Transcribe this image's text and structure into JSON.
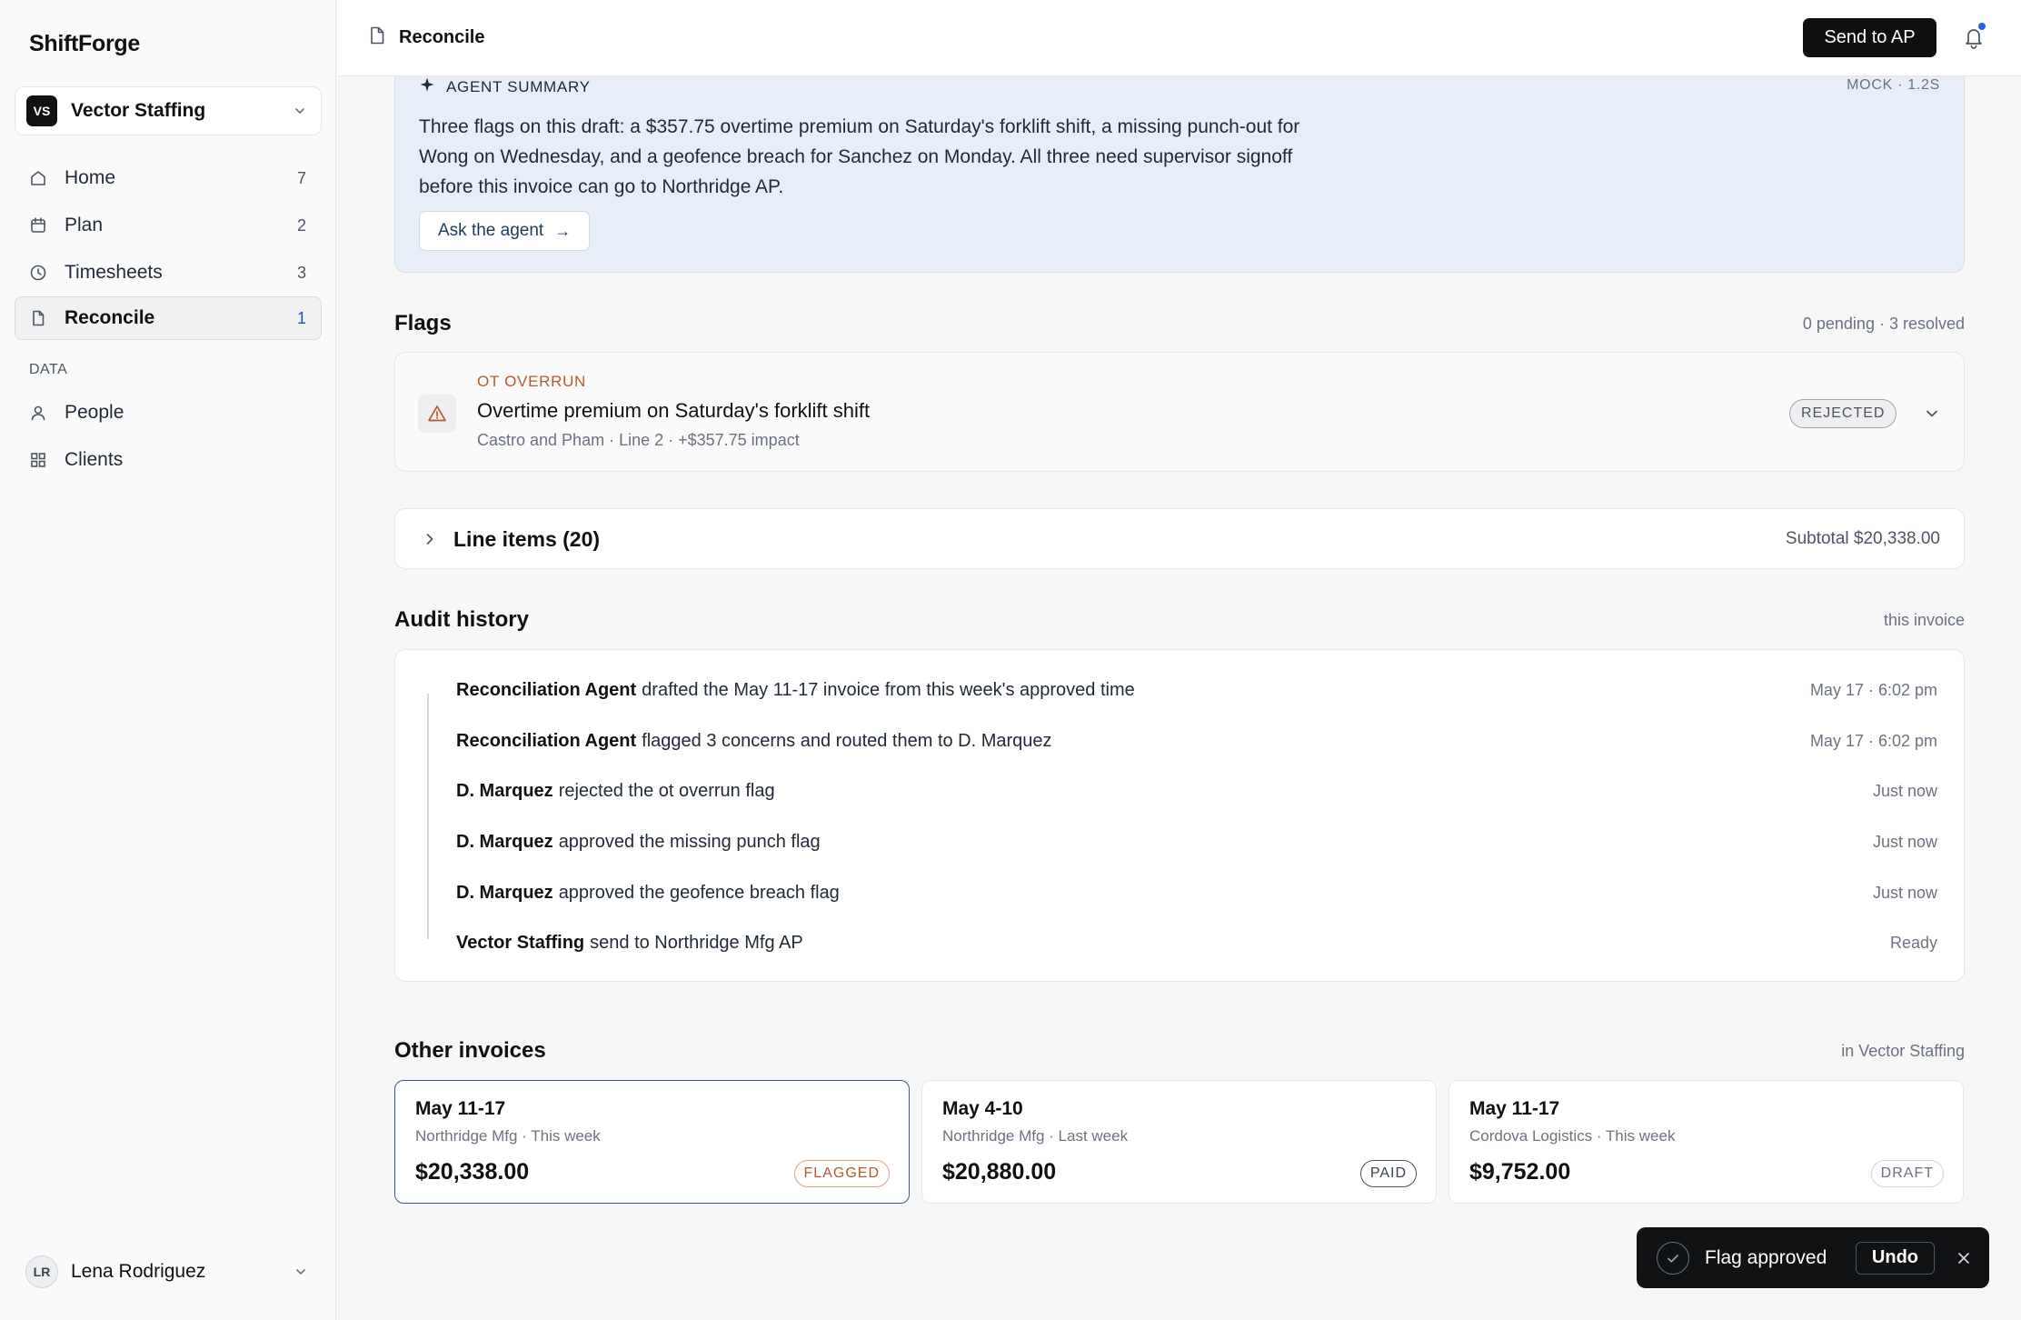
{
  "app": {
    "brand": "ShiftForge"
  },
  "workspace": {
    "initials": "VS",
    "name": "Vector Staffing"
  },
  "nav": [
    {
      "label": "Home",
      "count": "7",
      "icon": "home-icon"
    },
    {
      "label": "Plan",
      "count": "2",
      "icon": "calendar-icon"
    },
    {
      "label": "Timesheets",
      "count": "3",
      "icon": "clock-icon"
    },
    {
      "label": "Reconcile",
      "count": "1",
      "icon": "document-icon",
      "active": true
    }
  ],
  "data_section": {
    "label": "DATA",
    "items": [
      {
        "label": "People",
        "icon": "person-icon"
      },
      {
        "label": "Clients",
        "icon": "grid-icon"
      }
    ]
  },
  "user": {
    "initials": "LR",
    "name": "Lena Rodriguez"
  },
  "topbar": {
    "crumb": "Reconcile",
    "send_label": "Send to AP"
  },
  "agent": {
    "title": "AGENT SUMMARY",
    "meta": "MOCK · 1.2S",
    "text": "Three flags on this draft: a $357.75 overtime premium on Saturday's forklift shift, a missing punch-out for Wong on Wednesday, and a geofence breach for Sanchez on Monday. All three need supervisor signoff before this invoice can go to Northridge AP.",
    "ask_label": "Ask the agent",
    "ask_arrow": "→"
  },
  "flags": {
    "title": "Flags",
    "meta": "0 pending · 3 resolved",
    "item": {
      "type": "OT OVERRUN",
      "title": "Overtime premium on Saturday's forklift shift",
      "sub": "Castro and Pham · Line 2 · +$357.75 impact",
      "status": "REJECTED"
    }
  },
  "line_items": {
    "title": "Line items (20)",
    "subtotal": "Subtotal $20,338.00"
  },
  "audit": {
    "title": "Audit history",
    "meta": "this invoice",
    "rows": [
      {
        "actor": "Reconciliation Agent",
        "action": "drafted the May 11-17 invoice from this week's approved time",
        "time": "May 17 · 6:02 pm"
      },
      {
        "actor": "Reconciliation Agent",
        "action": "flagged 3 concerns and routed them to D. Marquez",
        "time": "May 17 · 6:02 pm"
      },
      {
        "actor": "D. Marquez",
        "action": "rejected the ot overrun flag",
        "time": "Just now"
      },
      {
        "actor": "D. Marquez",
        "action": "approved the missing punch flag",
        "time": "Just now"
      },
      {
        "actor": "D. Marquez",
        "action": "approved the geofence breach flag",
        "time": "Just now"
      },
      {
        "actor": "Vector Staffing",
        "action": "send to Northridge Mfg AP",
        "time": "Ready"
      }
    ]
  },
  "other_invoices": {
    "title": "Other invoices",
    "meta": "in Vector Staffing",
    "items": [
      {
        "title": "May 11-17",
        "sub": "Northridge Mfg · This week",
        "amount": "$20,338.00",
        "status": "FLAGGED",
        "status_color": "#b35a2e",
        "selected": true
      },
      {
        "title": "May 4-10",
        "sub": "Northridge Mfg · Last week",
        "amount": "$20,880.00",
        "status": "PAID",
        "status_color": "#374151"
      },
      {
        "title": "May 11-17",
        "sub": "Cordova Logistics · This week",
        "amount": "$9,752.00",
        "status": "DRAFT",
        "status_color": "#6b7280"
      }
    ]
  },
  "toast": {
    "label": "Flag approved",
    "undo_label": "Undo"
  }
}
